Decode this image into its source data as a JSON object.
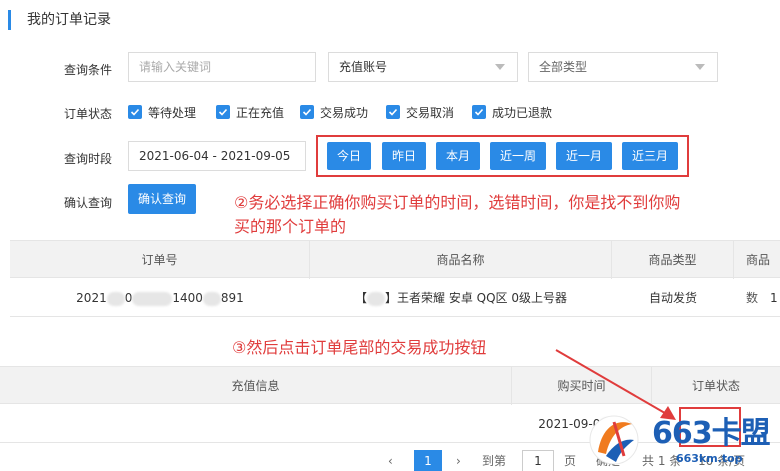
{
  "page_title": "我的订单记录",
  "filters": {
    "query_label": "查询条件",
    "keyword_placeholder": "请输入关键词",
    "account_select": "充值账号",
    "type_select": "全部类型",
    "status_label": "订单状态",
    "statuses": [
      "等待处理",
      "正在充值",
      "交易成功",
      "交易取消",
      "成功已退款"
    ],
    "time_label": "查询时段",
    "date_range": "2021-06-04 - 2021-09-05",
    "quick_ranges": [
      "今日",
      "昨日",
      "本月",
      "近一周",
      "近一月",
      "近三月"
    ],
    "confirm_label": "确认查询",
    "confirm_button": "确认查询"
  },
  "annotations": {
    "note2_line1": "②务必选择正确你购买订单的时间，选错时间，你是找不到你购",
    "note2_line2": "买的那个订单的",
    "note3": "③然后点击订单尾部的交易成功按钮"
  },
  "table1": {
    "headers": [
      "订单号",
      "商品名称",
      "商品类型",
      "商品数"
    ],
    "row": {
      "order_no_a": "2021",
      "order_no_b": "0",
      "order_no_c": "1400",
      "order_no_d": "891",
      "product_prefix": "【",
      "product_suffix": "】王者荣耀 安卓 QQ区 0级上号器",
      "type": "自动发货",
      "qty": "1"
    }
  },
  "table2": {
    "headers": [
      "充值信息",
      "购买时间",
      "订单状态"
    ],
    "row": {
      "purchase_time": "2021-09-0",
      "purchase_time_tail": "21"
    }
  },
  "pager": {
    "current": "1",
    "goto_label": "到第",
    "page_input": "1",
    "page_unit": "页",
    "confirm": "确定",
    "total": "共 1 条",
    "per_page": "10 条/页"
  },
  "watermark": {
    "brand": "663卡盟",
    "url": "663km.top"
  },
  "colors": {
    "accent": "#2a8ae6",
    "annotation": "#e03c3c"
  }
}
